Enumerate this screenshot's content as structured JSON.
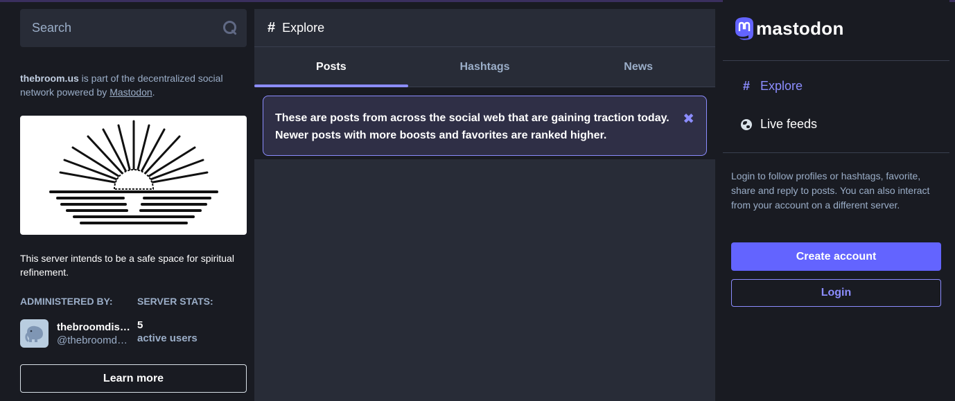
{
  "search": {
    "placeholder": "Search",
    "icon": "search-icon"
  },
  "server": {
    "domain": "thebroom.us",
    "about_suffix": " is part of the decentralized social network powered by ",
    "mastodon_link": "Mastodon",
    "about_end": ".",
    "description": "This server intends to be a safe space for spiritual refinement.",
    "administered_by_label": "ADMINISTERED BY:",
    "server_stats_label": "SERVER STATS:",
    "admin_display_name": "thebroomdis…",
    "admin_account": "@thebroomd…",
    "active_users_count": "5",
    "active_users_label": "active users",
    "learn_more": "Learn more"
  },
  "column": {
    "title": "Explore",
    "tabs": [
      {
        "label": "Posts",
        "active": true
      },
      {
        "label": "Hashtags",
        "active": false
      },
      {
        "label": "News",
        "active": false
      }
    ],
    "info_line1": "These are posts from across the social web that are gaining traction today.",
    "info_line2": "Newer posts with more boosts and favorites are ranked higher."
  },
  "nav": {
    "brand": "mastodon",
    "explore": "Explore",
    "live_feeds": "Live feeds"
  },
  "signup": {
    "text": "Login to follow profiles or hashtags, favorite, share and reply to posts. You can also interact from your account on a different server.",
    "create_account": "Create account",
    "login": "Login"
  },
  "colors": {
    "background": "#191b22",
    "panel": "#282c37",
    "accent": "#6364ff",
    "accent_light": "#8c8dff",
    "muted_text": "#9baec8"
  }
}
